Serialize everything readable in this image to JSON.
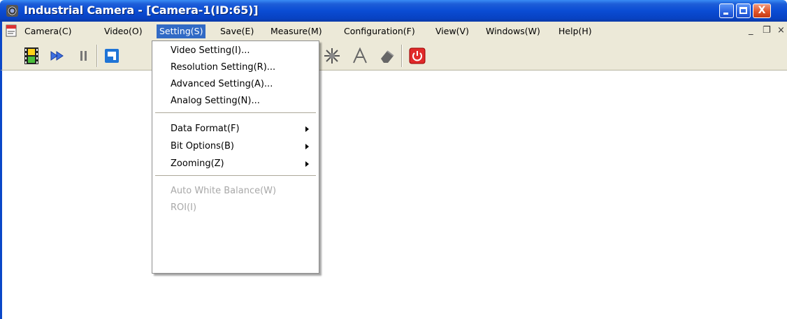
{
  "window": {
    "title": "Industrial Camera - [Camera-1(ID:65)]",
    "controls": {
      "minimize_icon": "minimize-icon",
      "maximize_icon": "maximize-icon",
      "close_icon": "close-icon",
      "close_glyph": "X"
    }
  },
  "menubar": {
    "items": [
      {
        "label": "Camera(C)"
      },
      {
        "label": "Video(O)"
      },
      {
        "label": "Setting(S)",
        "active": true
      },
      {
        "label": "Save(E)"
      },
      {
        "label": "Measure(M)"
      },
      {
        "label": "Configuration(F)"
      },
      {
        "label": "View(V)"
      },
      {
        "label": "Windows(W)"
      },
      {
        "label": "Help(H)"
      }
    ],
    "mdi_controls": {
      "minimize": "_",
      "restore": "❐",
      "close": "×"
    }
  },
  "toolbar": {
    "icons": [
      "film-strip-icon",
      "play-icon",
      "pause-icon",
      "snapshot-icon",
      "measure-icon",
      "text-icon",
      "eraser-icon",
      "power-icon"
    ]
  },
  "setting_menu": {
    "items": [
      {
        "label": "Video Setting(I)..."
      },
      {
        "label": "Resolution Setting(R)..."
      },
      {
        "label": "Advanced Setting(A)..."
      },
      {
        "label": "Analog Setting(N)..."
      },
      {
        "label": "Data Format(F)",
        "submenu": true
      },
      {
        "label": "Bit Options(B)",
        "submenu": true
      },
      {
        "label": "Zooming(Z)",
        "submenu": true
      },
      {
        "label": "Auto White Balance(W)",
        "disabled": true
      },
      {
        "label": "ROI(I)",
        "disabled": true
      }
    ]
  },
  "colors": {
    "title_bar": "#0a4cd4",
    "menu_highlight": "#316ac5",
    "chrome": "#ece9d8",
    "disabled_text": "#a8a8a8",
    "power_button": "#e02a2a"
  }
}
